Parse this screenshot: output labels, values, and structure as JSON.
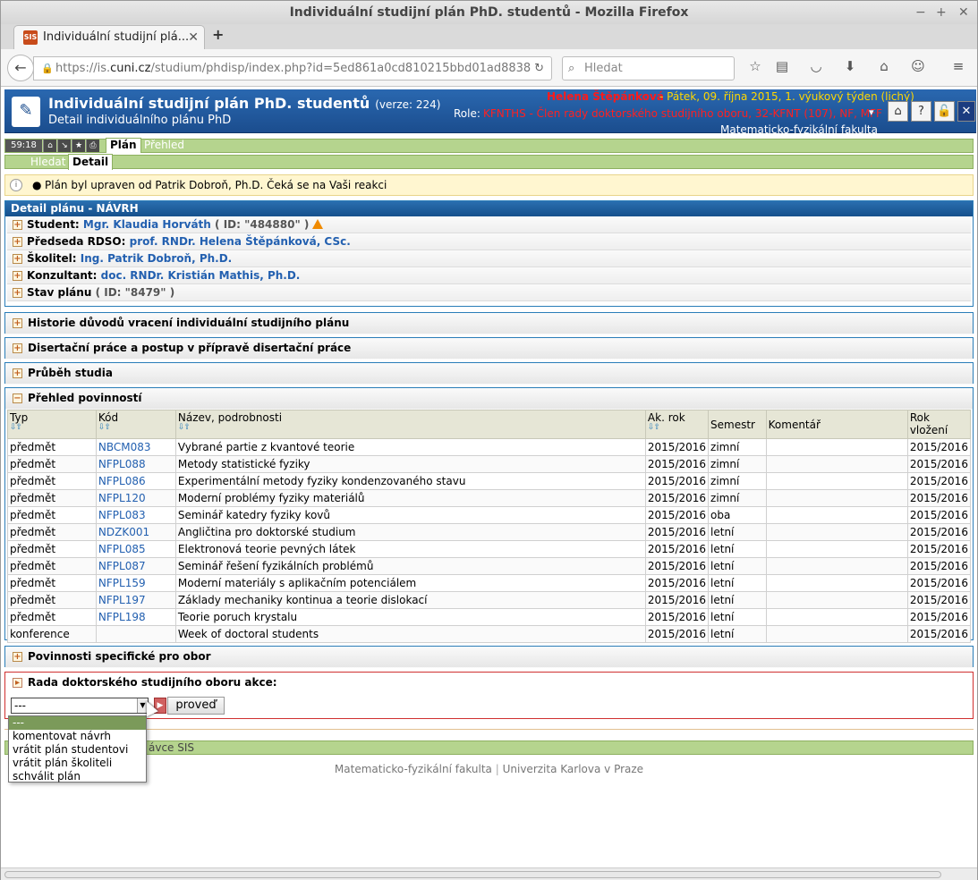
{
  "window": {
    "title": "Individuální studijní plán PhD. studentů - Mozilla Firefox",
    "controls": [
      "−",
      "+",
      "✕"
    ]
  },
  "tab": {
    "favicon": "SIS",
    "title": "Individuální studijní plá...",
    "close": "✕",
    "new": "+"
  },
  "nav": {
    "url_prefix": "https://is.",
    "url_domain": "cuni.cz",
    "url_rest": "/studium/phdisp/index.php?id=5ed861a0cd810215bbd01ad8838",
    "search_placeholder": "Hledat"
  },
  "header": {
    "title": "Individuální studijní plán PhD. studentů",
    "version": "(verze: 224)",
    "subtitle": "Detail individuálního plánu PhD",
    "user": "Helena Štěpánková",
    "date": "-  Pátek, 09. října 2015, 1. výukový týden (lichý)",
    "role_label": "Role:",
    "role": "KFNTHS - Člen rady doktorského studijního oboru, 32-KFNT (107), NF, MFF",
    "faculty": "Matematicko-fyzikální fakulta"
  },
  "menubar": {
    "clock": "59:18",
    "tabs": {
      "plan": "Plán",
      "prehled": "Přehled"
    },
    "subtabs": {
      "hledat": "Hledat",
      "detail": "Detail"
    }
  },
  "message": "Plán byl upraven od Patrik Dobroň, Ph.D. Čeká se na Vaši reakci",
  "detail": {
    "heading": "Detail plánu - NÁVRH",
    "student_label": "Student:",
    "student_name": "Mgr. Klaudia Horváth",
    "student_id": "( ID: \"484880\" )",
    "predseda_label": "Předseda RDSO:",
    "predseda_name": "prof. RNDr. Helena Štěpánková, CSc.",
    "skolitel_label": "Školitel:",
    "skolitel_name": "Ing. Patrik Dobroň, Ph.D.",
    "konzultant_label": "Konzultant:",
    "konzultant_name": "doc. RNDr. Kristián Mathis, Ph.D.",
    "stav_label": "Stav plánu",
    "stav_id": "( ID: \"8479\" )"
  },
  "sections": {
    "historie": "Historie důvodů vracení individuální studijního plánu",
    "disertace": "Disertační práce a postup v přípravě disertační práce",
    "prubeh": "Průběh studia",
    "prehled": "Přehled povinností",
    "specificke": "Povinnosti specifické pro obor",
    "akce": "Rada doktorského studijního oboru akce:"
  },
  "table": {
    "headers": {
      "typ": "Typ",
      "kod": "Kód",
      "nazev": "Název, podrobnosti",
      "akrok": "Ak. rok",
      "semestr": "Semestr",
      "komentar": "Komentář",
      "rok1": "Rok",
      "rok2": "vložení"
    },
    "rows": [
      [
        "předmět",
        "NBCM083",
        "Vybrané partie z kvantové teorie",
        "2015/2016",
        "zimní",
        "",
        "2015/2016"
      ],
      [
        "předmět",
        "NFPL088",
        "Metody statistické fyziky",
        "2015/2016",
        "zimní",
        "",
        "2015/2016"
      ],
      [
        "předmět",
        "NFPL086",
        "Experimentální metody fyziky kondenzovaného stavu",
        "2015/2016",
        "zimní",
        "",
        "2015/2016"
      ],
      [
        "předmět",
        "NFPL120",
        "Moderní problémy fyziky materiálů",
        "2015/2016",
        "zimní",
        "",
        "2015/2016"
      ],
      [
        "předmět",
        "NFPL083",
        "Seminář katedry fyziky kovů",
        "2015/2016",
        "oba",
        "",
        "2015/2016"
      ],
      [
        "předmět",
        "NDZK001",
        "Angličtina pro doktorské studium",
        "2015/2016",
        "letní",
        "",
        "2015/2016"
      ],
      [
        "předmět",
        "NFPL085",
        "Elektronová teorie pevných látek",
        "2015/2016",
        "letní",
        "",
        "2015/2016"
      ],
      [
        "předmět",
        "NFPL087",
        "Seminář řešení fyzikálních problémů",
        "2015/2016",
        "letní",
        "",
        "2015/2016"
      ],
      [
        "předmět",
        "NFPL159",
        "Moderní materiály s aplikačním potenciálem",
        "2015/2016",
        "letní",
        "",
        "2015/2016"
      ],
      [
        "předmět",
        "NFPL197",
        "Základy mechaniky kontinua a teorie dislokací",
        "2015/2016",
        "letní",
        "",
        "2015/2016"
      ],
      [
        "předmět",
        "NFPL198",
        "Teorie poruch krystalu",
        "2015/2016",
        "letní",
        "",
        "2015/2016"
      ],
      [
        "konference",
        "",
        "Week of doctoral students",
        "2015/2016",
        "letní",
        "",
        "2015/2016"
      ]
    ]
  },
  "action": {
    "selected": "---",
    "button": "proveď",
    "options": [
      "---",
      "komentovat návrh",
      "vrátit plán studentovi",
      "vrátit plán školiteli",
      "schválit plán"
    ]
  },
  "bottom_bar": "ávce SIS",
  "footer": {
    "left": "Matematicko-fyzikální fakulta",
    "sep": "|",
    "right": "Univerzita Karlova v Praze"
  }
}
